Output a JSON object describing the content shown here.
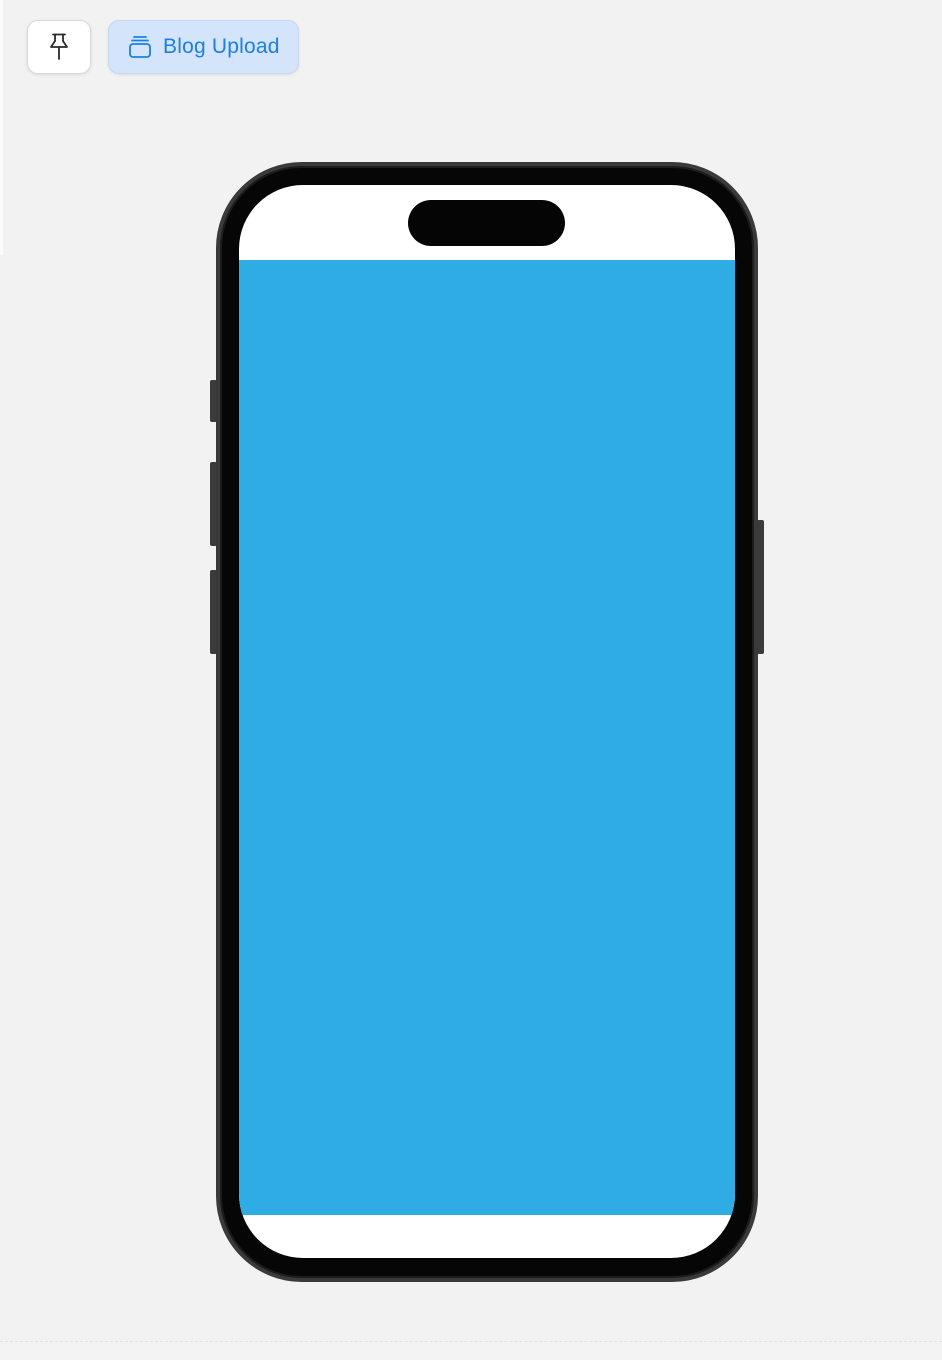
{
  "toolbar": {
    "pin_icon": "pin-icon",
    "preview_icon": "stacked-window-icon",
    "preview_label": "Blog Upload"
  },
  "colors": {
    "background": "#f2f2f2",
    "accent": "#1b7fe5",
    "pill_background": "#d4e4fa",
    "screen_content": "#30ace4",
    "phone_frame": "#060606"
  }
}
